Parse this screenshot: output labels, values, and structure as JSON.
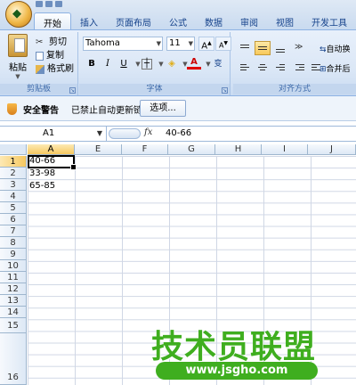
{
  "app": {
    "office_button_glyph": "◆",
    "accent_color": "#15428b",
    "watermark_color": "#3fae1f"
  },
  "tabs": [
    {
      "label": "开始"
    },
    {
      "label": "插入"
    },
    {
      "label": "页面布局"
    },
    {
      "label": "公式"
    },
    {
      "label": "数据"
    },
    {
      "label": "审阅"
    },
    {
      "label": "视图"
    },
    {
      "label": "开发工具"
    }
  ],
  "ribbon": {
    "clipboard": {
      "paste_label": "粘贴",
      "cut_label": "剪切",
      "copy_label": "复制",
      "format_painter_label": "格式刷",
      "group_label": "剪贴板"
    },
    "font": {
      "font_name": "Tahoma",
      "font_size": "11",
      "grow_label": "A",
      "shrink_label": "A",
      "bold": "B",
      "italic": "I",
      "underline": "U",
      "font_color_glyph": "A",
      "phonetic_glyph": "变",
      "group_label": "字体"
    },
    "alignment": {
      "wrap_label": "自动换",
      "merge_label": "合并后",
      "group_label": "对齐方式"
    }
  },
  "security": {
    "title": "安全警告",
    "message": "已禁止自动更新链接",
    "options_button": "选项..."
  },
  "formula_bar": {
    "name_box": "A1",
    "fx": "fx",
    "formula": "40-66"
  },
  "grid": {
    "columns": [
      "A",
      "E",
      "F",
      "G",
      "H",
      "I",
      "J"
    ],
    "rows": [
      "1",
      "2",
      "3",
      "4",
      "5",
      "6",
      "7",
      "8",
      "9",
      "10",
      "11",
      "12",
      "13",
      "14",
      "15",
      "16"
    ],
    "cells": [
      {
        "ref": "A1",
        "value": "40-66"
      },
      {
        "ref": "A2",
        "value": "33-98"
      },
      {
        "ref": "A3",
        "value": "65-85"
      }
    ]
  },
  "watermark": {
    "title": "技术员联盟",
    "url": "www.jsgho.com"
  }
}
